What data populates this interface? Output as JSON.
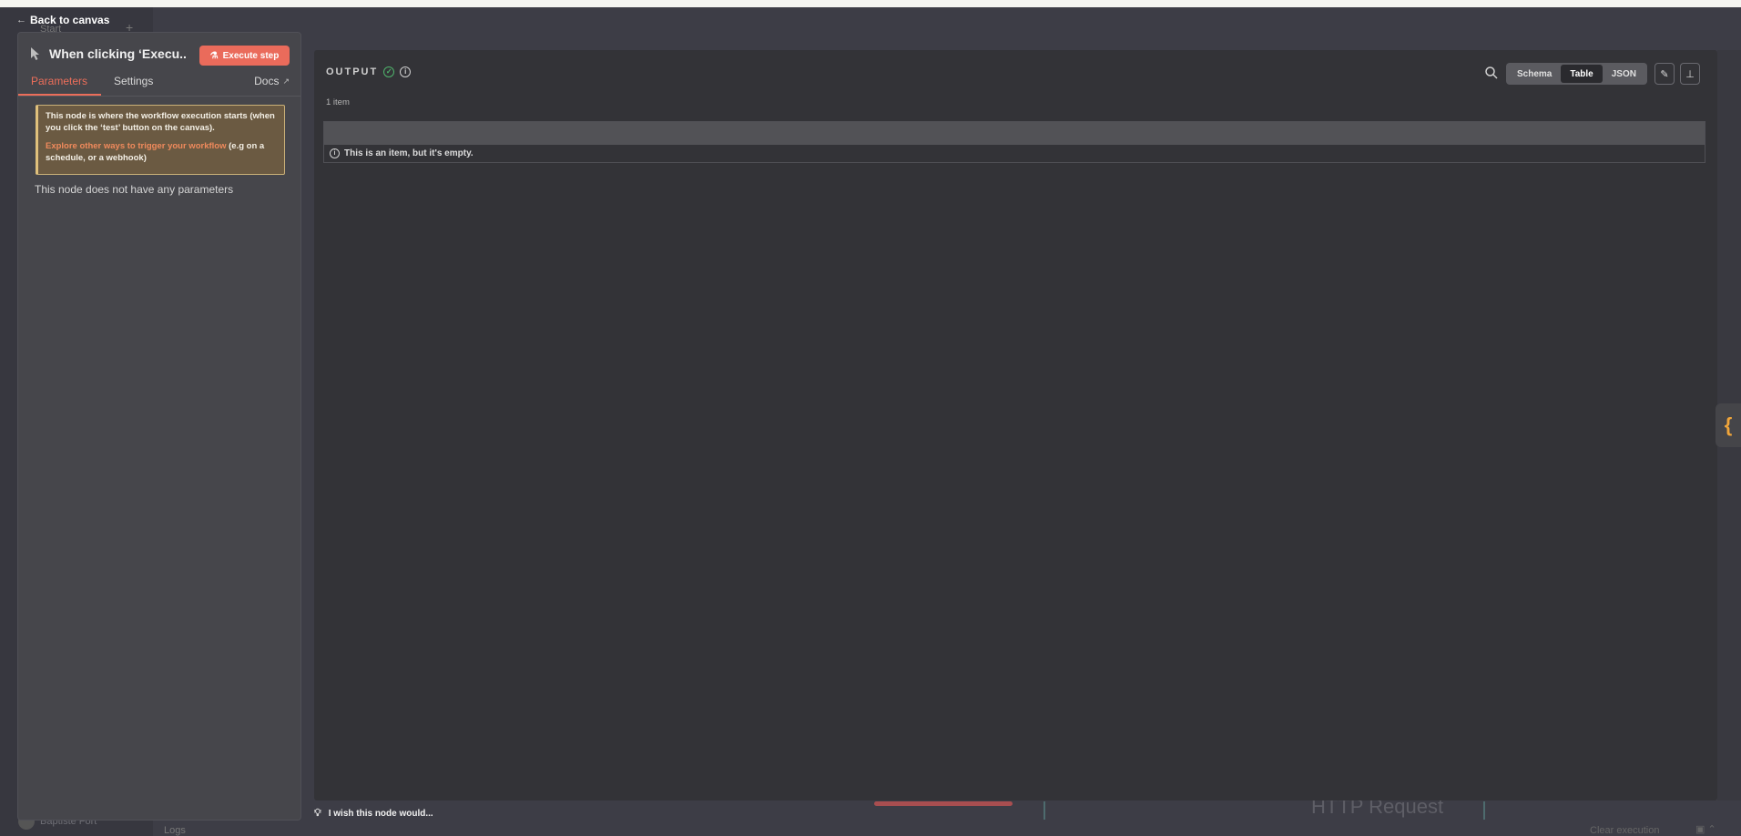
{
  "app": {
    "back_label": "Back to canvas"
  },
  "background": {
    "start_label": "Start",
    "user_name": "Baptiste Fort",
    "logs_label": "Logs",
    "http_node_label": "HTTP Request",
    "clear_execution_label": "Clear execution"
  },
  "node": {
    "title": "When clicking ‘Execu...",
    "execute_label": "Execute step",
    "tabs": [
      {
        "label": "Parameters",
        "active": true
      },
      {
        "label": "Settings",
        "active": false
      }
    ],
    "docs_label": "Docs",
    "notice": {
      "line1": "This node is where the workflow execution starts (when you click the ‘test’ button on the canvas).",
      "link": "Explore other ways to trigger your workflow",
      "line2_rest": " (e.g on a schedule, or a webhook)"
    },
    "empty_params": "This node does not have any parameters"
  },
  "output": {
    "title": "OUTPUT",
    "item_count": "1 item",
    "views": [
      {
        "label": "Schema",
        "active": false
      },
      {
        "label": "Table",
        "active": true
      },
      {
        "label": "JSON",
        "active": false
      }
    ],
    "empty_item_message": "This is an item, but it's empty."
  },
  "footer": {
    "feedback": "I wish this node would..."
  },
  "colors": {
    "accent": "#ec6e5a",
    "execute_button": "#ea6b5b",
    "success": "#4fb36b",
    "notice_border": "#dfc07c",
    "side_tab_icon": "#f0a53a"
  },
  "icons": {
    "node": "cursor-icon",
    "execute": "flask-icon",
    "docs": "external-link-icon",
    "status": "check-circle-icon",
    "info": "info-icon",
    "search": "search-icon",
    "edit": "pencil-icon",
    "pin": "pin-icon",
    "feedback": "lightbulb-icon",
    "side_tab": "curly-braces-icon"
  }
}
